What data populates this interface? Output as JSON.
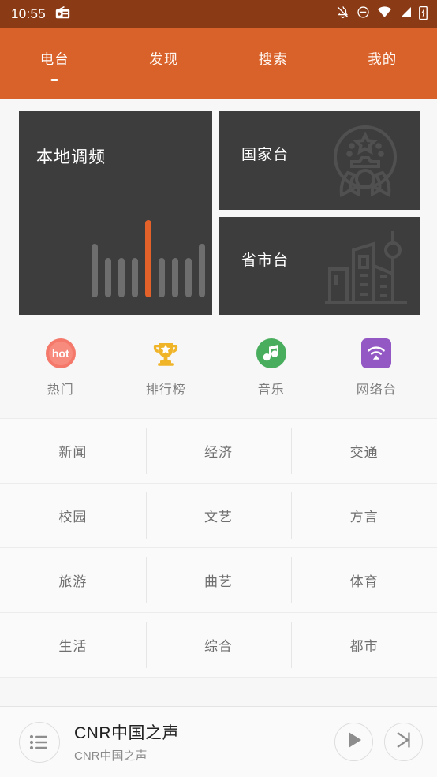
{
  "status_bar": {
    "time": "10:55",
    "app_icon": "radio-icon",
    "icons": [
      "notifications-off-icon",
      "do-not-disturb-icon",
      "wifi-icon",
      "cellular-signal-icon",
      "battery-charging-icon"
    ],
    "background_color": "#8b3a16"
  },
  "tabs": {
    "accent_color": "#d9622a",
    "items": [
      {
        "label": "电台",
        "active": true
      },
      {
        "label": "发现",
        "active": false
      },
      {
        "label": "搜索",
        "active": false
      },
      {
        "label": "我的",
        "active": false
      }
    ]
  },
  "hero": {
    "local_fm": {
      "title": "本地调频",
      "icon": "equalizer-bars-icon",
      "accent_color": "#e4622a",
      "card_color": "#3d3d3d"
    },
    "national": {
      "title": "国家台",
      "icon": "national-emblem-icon"
    },
    "provincial": {
      "title": "省市台",
      "icon": "city-skyline-icon"
    }
  },
  "quick_links": [
    {
      "label": "热门",
      "icon": "hot-badge-icon",
      "icon_text": "hot",
      "color": "#f4796b"
    },
    {
      "label": "排行榜",
      "icon": "trophy-icon",
      "color": "#f0b429"
    },
    {
      "label": "音乐",
      "icon": "music-note-icon",
      "color": "#49ad5e"
    },
    {
      "label": "网络台",
      "icon": "wifi-broadcast-icon",
      "color": "#9358c4"
    }
  ],
  "categories": [
    [
      "新闻",
      "经济",
      "交通"
    ],
    [
      "校园",
      "文艺",
      "方言"
    ],
    [
      "旅游",
      "曲艺",
      "体育"
    ],
    [
      "生活",
      "综合",
      "都市"
    ]
  ],
  "player": {
    "playlist_icon": "playlist-icon",
    "title": "CNR中国之声",
    "subtitle": "CNR中国之声",
    "play_icon": "play-icon",
    "next_icon": "skip-next-icon"
  }
}
